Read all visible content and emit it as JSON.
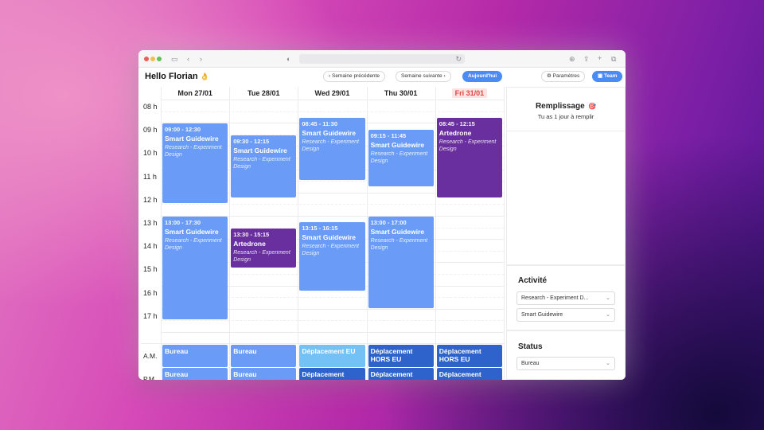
{
  "header": {
    "greeting": "Hello Florian",
    "greeting_emoji": "👌",
    "prev_week": "Semaine précédente",
    "next_week": "Semaine suivante",
    "today": "Aujourd'hui",
    "settings": "Paramètres",
    "team": "Team"
  },
  "calendar": {
    "days": [
      {
        "label": "Mon 27/01",
        "today": false
      },
      {
        "label": "Tue 28/01",
        "today": false
      },
      {
        "label": "Wed 29/01",
        "today": false
      },
      {
        "label": "Thu 30/01",
        "today": false
      },
      {
        "label": "Fri 31/01",
        "today": true
      }
    ],
    "hours": [
      "08 h",
      "09 h",
      "10 h",
      "11 h",
      "12 h",
      "13 h",
      "14 h",
      "15 h",
      "16 h",
      "17 h"
    ],
    "events": [
      {
        "day": 0,
        "start": 9.0,
        "end": 12.5,
        "time": "09:00 - 12:30",
        "name": "Smart Guidewire",
        "sub": "Research - Experiment Design",
        "color": "blue"
      },
      {
        "day": 0,
        "start": 13.0,
        "end": 17.5,
        "time": "13:00 - 17:30",
        "name": "Smart Guidewire",
        "sub": "Research - Experiment Design",
        "color": "blue"
      },
      {
        "day": 1,
        "start": 9.5,
        "end": 12.25,
        "time": "09:30 - 12:15",
        "name": "Smart Guidewire",
        "sub": "Research - Experiment Design",
        "color": "blue"
      },
      {
        "day": 1,
        "start": 13.5,
        "end": 15.25,
        "time": "13:30 - 15:15",
        "name": "Artedrone",
        "sub": "Research - Experiment Design",
        "color": "purple"
      },
      {
        "day": 2,
        "start": 8.75,
        "end": 11.5,
        "time": "08:45 - 11:30",
        "name": "Smart Guidewire",
        "sub": "Research - Experiment Design",
        "color": "blue"
      },
      {
        "day": 2,
        "start": 13.25,
        "end": 16.25,
        "time": "13:15 - 16:15",
        "name": "Smart Guidewire",
        "sub": "Research - Experiment Design",
        "color": "blue"
      },
      {
        "day": 3,
        "start": 9.25,
        "end": 11.75,
        "time": "09:15 - 11:45",
        "name": "Smart Guidewire",
        "sub": "Research - Experiment Design",
        "color": "blue"
      },
      {
        "day": 3,
        "start": 13.0,
        "end": 17.0,
        "time": "13:00 - 17:00",
        "name": "Smart Guidewire",
        "sub": "Research - Experiment Design",
        "color": "blue"
      },
      {
        "day": 4,
        "start": 8.75,
        "end": 12.25,
        "time": "08:45 - 12:15",
        "name": "Artedrone",
        "sub": "Research - Experiment Design",
        "color": "purple"
      }
    ],
    "am_label": "A.M.",
    "pm_label": "P.M.",
    "am": [
      {
        "text": "Bureau",
        "style": "light"
      },
      {
        "text": "Bureau",
        "style": "light"
      },
      {
        "text": "Déplacement EU",
        "style": "cyan"
      },
      {
        "text": "Déplacement HORS EU",
        "style": "dark"
      },
      {
        "text": "Déplacement HORS EU",
        "style": "dark"
      }
    ],
    "pm": [
      {
        "text": "Bureau",
        "style": "light"
      },
      {
        "text": "Bureau",
        "style": "light"
      },
      {
        "text": "Déplacement HORS EU",
        "style": "dark"
      },
      {
        "text": "Déplacement HORS EU",
        "style": "dark"
      },
      {
        "text": "Déplacement HORS EU",
        "style": "dark"
      }
    ]
  },
  "remplissage": {
    "title": "Remplissage",
    "title_emoji": "🎯",
    "message": "Tu as 1 jour à remplir"
  },
  "activite": {
    "title": "Activité",
    "activity_select": "Research - Experiment D...",
    "project_select": "Smart Guidewire"
  },
  "status": {
    "title": "Status",
    "status_select": "Bureau"
  },
  "colors": {
    "event_blue": "#6a9cf7",
    "event_purple": "#6a2f9e",
    "slot_cyan": "#74c1f5",
    "slot_dark": "#2f63cc",
    "accent": "#4b8bf5",
    "today_red": "#e04545"
  }
}
